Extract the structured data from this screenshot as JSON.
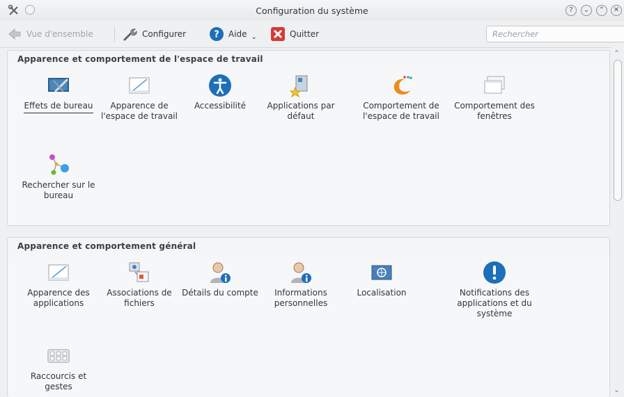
{
  "window": {
    "title": "Configuration du système",
    "controls": [
      "?",
      "⌄",
      "⌃",
      "✕"
    ]
  },
  "toolbar": {
    "overview_label": "Vue d'ensemble",
    "configure_label": "Configurer",
    "help_label": "Aide",
    "quit_label": "Quitter",
    "help_dropdown": "⌄"
  },
  "search": {
    "placeholder": "Rechercher"
  },
  "sections": [
    {
      "title": "Apparence et comportement de l'espace de travail",
      "items": [
        {
          "label": "Effets de bureau",
          "icon": "desktop-effects-icon"
        },
        {
          "label": "Apparence de l'espace de travail",
          "icon": "workspace-appearance-icon"
        },
        {
          "label": "Accessibilité",
          "icon": "accessibility-icon"
        },
        {
          "label": "Applications par défaut",
          "icon": "default-applications-icon"
        },
        {
          "label": "Comportement de l'espace de travail",
          "icon": "workspace-behavior-icon"
        },
        {
          "label": "Comportement des fenêtres",
          "icon": "window-behavior-icon"
        },
        {
          "label": "Rechercher sur le bureau",
          "icon": "desktop-search-icon"
        }
      ]
    },
    {
      "title": "Apparence et comportement général",
      "items": [
        {
          "label": "Apparence des applications",
          "icon": "application-appearance-icon"
        },
        {
          "label": "Associations de fichiers",
          "icon": "file-associations-icon"
        },
        {
          "label": "Détails du compte",
          "icon": "account-details-icon"
        },
        {
          "label": "Informations personnelles",
          "icon": "personal-information-icon"
        },
        {
          "label": "Localisation",
          "icon": "localization-icon"
        },
        {
          "label": "Notifications des applications et du système",
          "icon": "notifications-icon"
        },
        {
          "label": "Raccourcis et gestes",
          "icon": "shortcuts-icon"
        }
      ]
    }
  ],
  "colors": {
    "accent": "#1d6fb8",
    "background": "#eff0f1",
    "text": "#31363b"
  }
}
